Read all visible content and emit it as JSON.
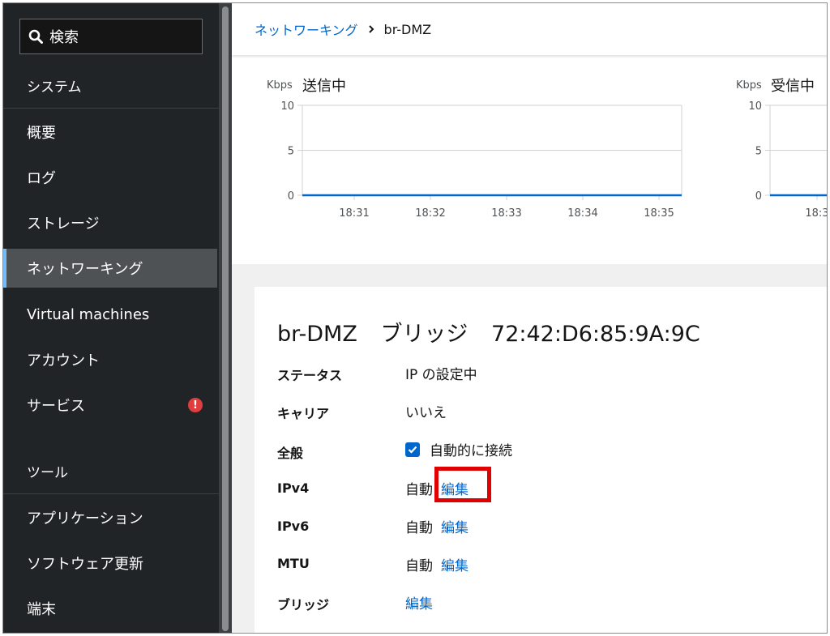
{
  "sidebar": {
    "search_placeholder": "検索",
    "sections": [
      {
        "title": "システム",
        "items": [
          {
            "label": "概要"
          },
          {
            "label": "ログ"
          },
          {
            "label": "ストレージ"
          },
          {
            "label": "ネットワーキング",
            "active": true
          },
          {
            "label": "Virtual machines"
          },
          {
            "label": "アカウント"
          },
          {
            "label": "サービス",
            "alert": true
          }
        ]
      },
      {
        "title": "ツール",
        "items": [
          {
            "label": "アプリケーション"
          },
          {
            "label": "ソフトウェア更新"
          },
          {
            "label": "端末"
          }
        ]
      }
    ],
    "alert_glyph": "!"
  },
  "breadcrumb": {
    "parent": "ネットワーキング",
    "current": "br-DMZ"
  },
  "charts": {
    "sending": {
      "title": "送信中",
      "unit": "Kbps"
    },
    "receiving": {
      "title": "受信中",
      "unit": "Kbps"
    }
  },
  "chart_data": [
    {
      "type": "line",
      "title": "送信中",
      "ylabel": "Kbps",
      "x": [
        "18:31",
        "18:32",
        "18:33",
        "18:34",
        "18:35"
      ],
      "ylim": [
        0,
        10
      ],
      "yticks": [
        0,
        5,
        10
      ],
      "series": [
        {
          "values": [
            0,
            0,
            0,
            0,
            0
          ]
        }
      ],
      "grid": true,
      "line_color": "#0066cc"
    },
    {
      "type": "line",
      "title": "受信中",
      "ylabel": "Kbps",
      "x": [
        "18:3"
      ],
      "ylim": [
        0,
        10
      ],
      "yticks": [
        0,
        5,
        10
      ],
      "series": [
        {
          "values": [
            0
          ]
        }
      ],
      "grid": true,
      "line_color": "#0066cc"
    }
  ],
  "details": {
    "name": "br-DMZ",
    "type": "ブリッジ",
    "mac": "72:42:D6:85:9A:9C",
    "rows": {
      "status": {
        "label": "ステータス",
        "value": "IP の設定中"
      },
      "carrier": {
        "label": "キャリア",
        "value": "いいえ"
      },
      "general": {
        "label": "全般",
        "value": "自動的に接続",
        "checked": true
      },
      "ipv4": {
        "label": "IPv4",
        "value": "自動",
        "link": "編集"
      },
      "ipv6": {
        "label": "IPv6",
        "value": "自動",
        "link": "編集"
      },
      "mtu": {
        "label": "MTU",
        "value": "自動",
        "link": "編集"
      },
      "bridge": {
        "label": "ブリッジ",
        "link": "編集"
      }
    }
  },
  "colors": {
    "accent": "#0066cc",
    "highlight": "#e10000",
    "sidebar_bg": "#212427",
    "alert": "#e03e3e"
  }
}
